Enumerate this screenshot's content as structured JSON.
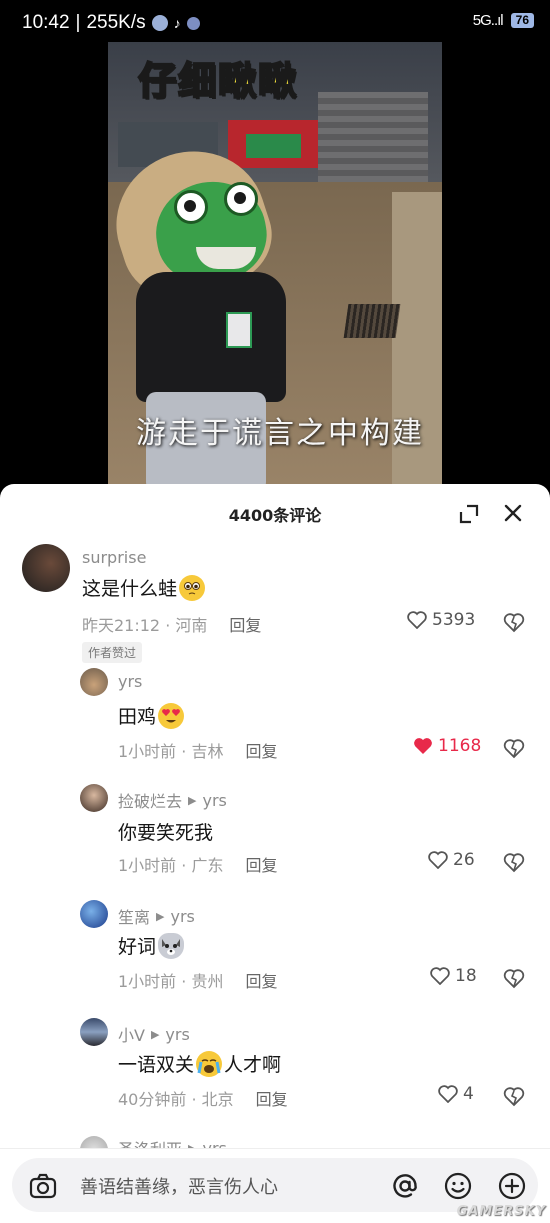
{
  "status_bar": {
    "time": "10:42",
    "network_speed": "255K/s",
    "signal": "5G..ıl",
    "battery": "76"
  },
  "video": {
    "caption_top": "仔细瞅瞅",
    "subtitle": "游走于谎言之中构建"
  },
  "comments_panel": {
    "title": "4400条评论",
    "comments": [
      {
        "user": "surprise",
        "text": "这是什么蛙",
        "emoji": "pleading-face",
        "time": "昨天21:12",
        "location": "河南",
        "reply_label": "回复",
        "likes": "5393",
        "liked": false,
        "author_tag": "作者赞过"
      },
      {
        "user": "yrs",
        "text": "田鸡",
        "emoji": "heart-eyes-face",
        "time": "1小时前",
        "location": "吉林",
        "reply_label": "回复",
        "likes": "1168",
        "liked": true
      },
      {
        "user": "捡破烂去",
        "reply_to": "yrs",
        "text": "你要笑死我",
        "time": "1小时前",
        "location": "广东",
        "reply_label": "回复",
        "likes": "26",
        "liked": false
      },
      {
        "user": "笙离",
        "reply_to": "yrs",
        "text": "好词",
        "emoji": "dog-face",
        "time": "1小时前",
        "location": "贵州",
        "reply_label": "回复",
        "likes": "18",
        "liked": false
      },
      {
        "user": "小V",
        "reply_to": "yrs",
        "text_before": "一语双关",
        "text_after": "人才啊",
        "emoji": "crying-face",
        "time": "40分钟前",
        "location": "北京",
        "reply_label": "回复",
        "likes": "4",
        "liked": false
      },
      {
        "user": "圣洛利亚",
        "reply_to": "yrs"
      }
    ]
  },
  "input": {
    "placeholder": "善语结善缘，恶言伤人心"
  },
  "watermark": "GAMERSKY",
  "colors": {
    "liked": "#e8294a",
    "muted_text": "#9b9b9b",
    "username": "#8c8c8c"
  }
}
